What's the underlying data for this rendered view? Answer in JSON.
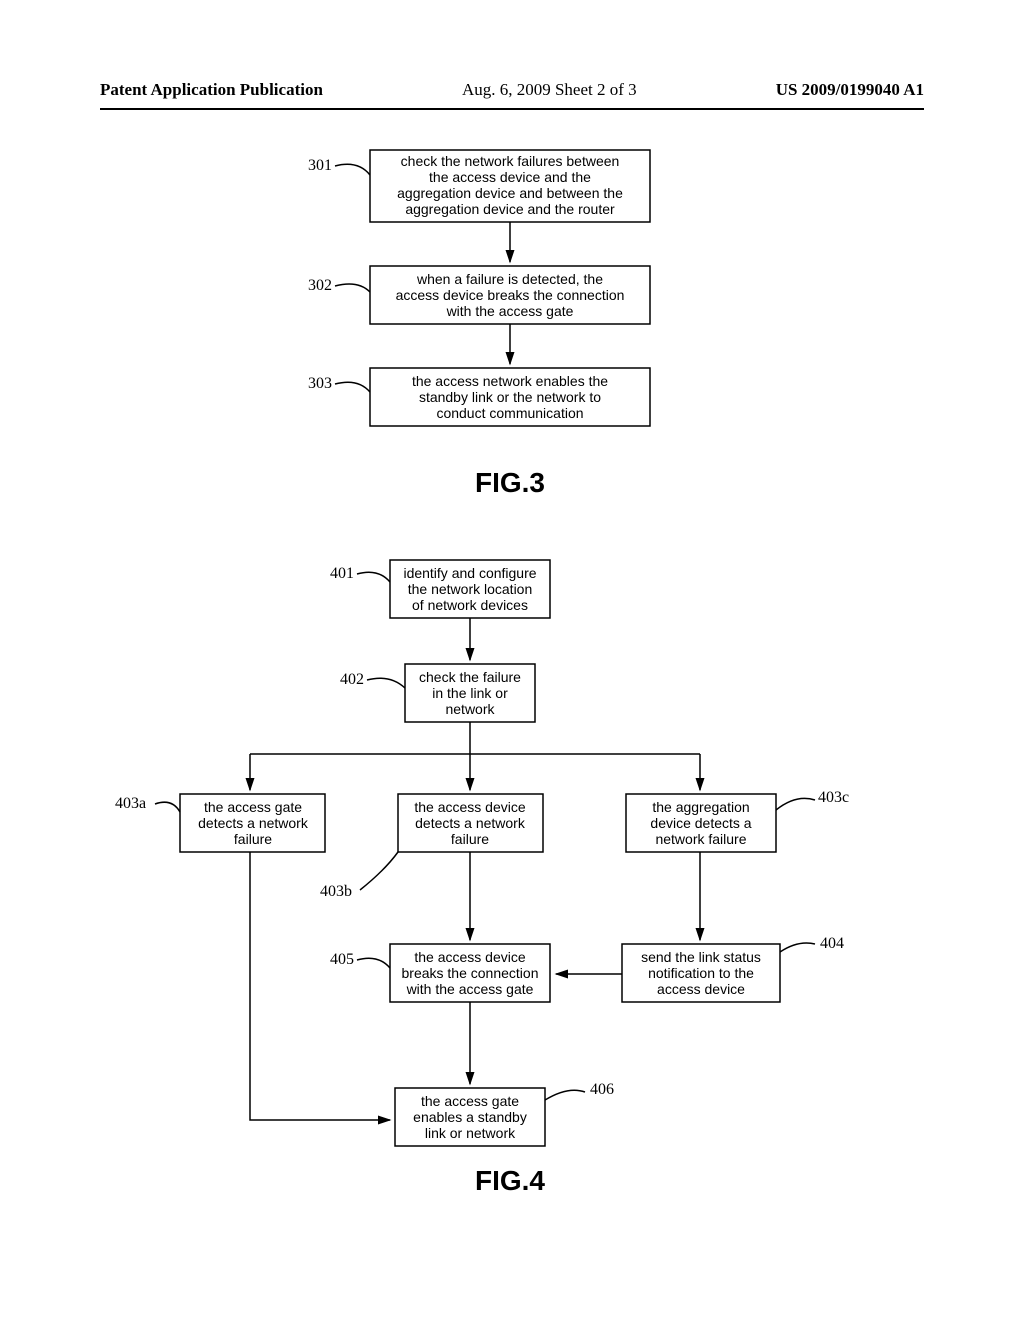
{
  "header": {
    "left": "Patent Application Publication",
    "center": "Aug. 6, 2009   Sheet 2 of 3",
    "right": "US 2009/0199040 A1"
  },
  "fig3": {
    "caption": "FIG.3",
    "ref301": "301",
    "ref302": "302",
    "ref303": "303",
    "box301_l1": "check the network failures between",
    "box301_l2": "the access device and the",
    "box301_l3": "aggregation device and between the",
    "box301_l4": "aggregation device and the router",
    "box302_l1": "when a failure is detected, the",
    "box302_l2": "access device breaks the connection",
    "box302_l3": "with the access gate",
    "box303_l1": "the access network enables the",
    "box303_l2": "standby link or the network to",
    "box303_l3": "conduct communication"
  },
  "fig4": {
    "caption": "FIG.4",
    "ref401": "401",
    "ref402": "402",
    "ref403a": "403a",
    "ref403b": "403b",
    "ref403c": "403c",
    "ref404": "404",
    "ref405": "405",
    "ref406": "406",
    "box401_l1": "identify and configure",
    "box401_l2": "the network location",
    "box401_l3": "of network devices",
    "box402_l1": "check the failure",
    "box402_l2": "in the link or",
    "box402_l3": "network",
    "box403a_l1": "the access gate",
    "box403a_l2": "detects a network",
    "box403a_l3": "failure",
    "box403b_l1": "the access device",
    "box403b_l2": "detects a network",
    "box403b_l3": "failure",
    "box403c_l1": "the aggregation",
    "box403c_l2": "device detects a",
    "box403c_l3": "network failure",
    "box404_l1": "send the link status",
    "box404_l2": "notification to the",
    "box404_l3": "access device",
    "box405_l1": "the access device",
    "box405_l2": "breaks the connection",
    "box405_l3": "with the access gate",
    "box406_l1": "the access gate",
    "box406_l2": "enables a standby",
    "box406_l3": "link or network"
  }
}
